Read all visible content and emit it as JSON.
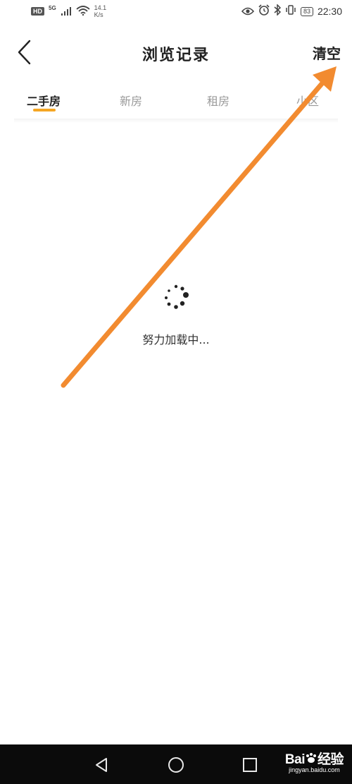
{
  "status_bar": {
    "hd": "HD",
    "network": "5G",
    "speed_value": "14.1",
    "speed_unit": "K/s",
    "battery": "83",
    "time": "22:30",
    "icons": [
      "signal-icon",
      "wifi-icon",
      "eye-icon",
      "alarm-icon",
      "bluetooth-icon",
      "vibrate-icon"
    ]
  },
  "header": {
    "title": "浏览记录",
    "clear_label": "清空",
    "back_icon": "chevron-left-icon"
  },
  "tabs": [
    {
      "label": "二手房",
      "active": true
    },
    {
      "label": "新房",
      "active": false
    },
    {
      "label": "租房",
      "active": false
    },
    {
      "label": "小区",
      "active": false
    }
  ],
  "loading": {
    "text": "努力加载中..."
  },
  "colors": {
    "accent": "#F5A623",
    "annotation_arrow": "#F28B30",
    "nav_bar": "#0B0B0B"
  },
  "nav_bar": {
    "buttons": [
      "back-triangle-icon",
      "home-circle-icon",
      "recents-square-icon"
    ]
  },
  "watermark": {
    "brand_main": "Bai",
    "brand_tail": "经验",
    "sub": "jingyan.baidu.com"
  }
}
